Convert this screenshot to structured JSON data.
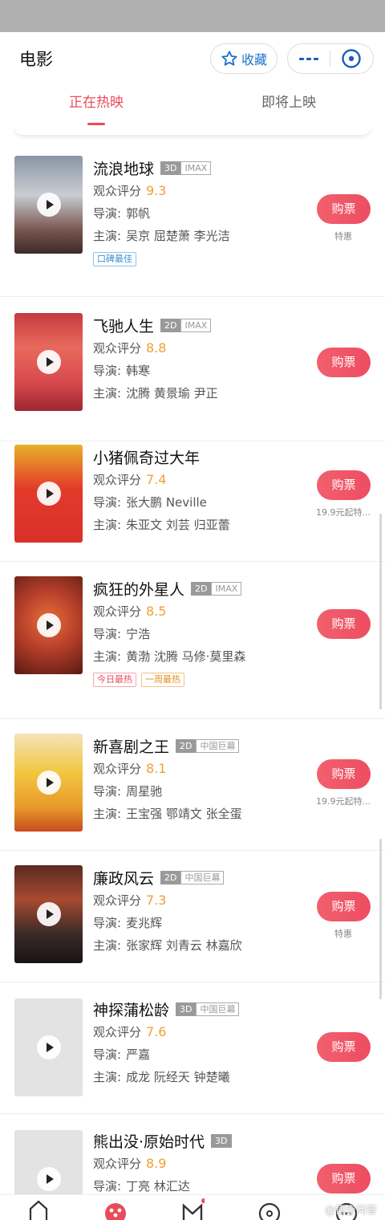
{
  "header": {
    "title": "电影",
    "favorite_label": "收藏"
  },
  "tabs": [
    {
      "label": "正在热映",
      "active": true
    },
    {
      "label": "即将上映",
      "active": false
    }
  ],
  "labels": {
    "score": "观众评分",
    "director": "导演:",
    "cast": "主演:",
    "buy": "购票"
  },
  "movies": [
    {
      "name": "流浪地球",
      "format": [
        "3D",
        "IMAX"
      ],
      "score": "9.3",
      "director": "郭帆",
      "cast": "吴京 屈楚萧 李光洁",
      "badges": [
        {
          "text": "口碑最佳",
          "color": "blue"
        }
      ],
      "buy_note": "特惠"
    },
    {
      "name": "飞驰人生",
      "format": [
        "2D",
        "IMAX"
      ],
      "score": "8.8",
      "director": "韩寒",
      "cast": "沈腾 黄景瑜 尹正",
      "badges": [],
      "buy_note": ""
    },
    {
      "name": "小猪佩奇过大年",
      "format": [],
      "score": "7.4",
      "director": "张大鹏 Neville",
      "cast": "朱亚文 刘芸 归亚蕾",
      "badges": [],
      "buy_note": "19.9元起特..."
    },
    {
      "name": "疯狂的外星人",
      "format": [
        "2D",
        "IMAX"
      ],
      "score": "8.5",
      "director": "宁浩",
      "cast": "黄渤 沈腾 马修·莫里森",
      "badges": [
        {
          "text": "今日最热",
          "color": "red"
        },
        {
          "text": "一周最热",
          "color": "orange"
        }
      ],
      "buy_note": ""
    },
    {
      "name": "新喜剧之王",
      "format": [
        "2D",
        "中国巨幕"
      ],
      "score": "8.1",
      "director": "周星驰",
      "cast": "王宝强 鄂靖文 张全蛋",
      "badges": [],
      "buy_note": "19.9元起特..."
    },
    {
      "name": "廉政风云",
      "format": [
        "2D",
        "中国巨幕"
      ],
      "score": "7.3",
      "director": "麦兆辉",
      "cast": "张家辉 刘青云 林嘉欣",
      "badges": [],
      "buy_note": "特惠"
    },
    {
      "name": "神探蒲松龄",
      "format": [
        "3D",
        "中国巨幕"
      ],
      "score": "7.6",
      "director": "严嘉",
      "cast": "成龙 阮经天 钟楚曦",
      "badges": [],
      "buy_note": ""
    },
    {
      "name": "熊出没·原始时代",
      "format": [
        "3D"
      ],
      "score": "8.9",
      "director": "丁亮 林汇达",
      "cast": "",
      "badges": [],
      "buy_note": ""
    }
  ],
  "watermark": "@悟空问答"
}
